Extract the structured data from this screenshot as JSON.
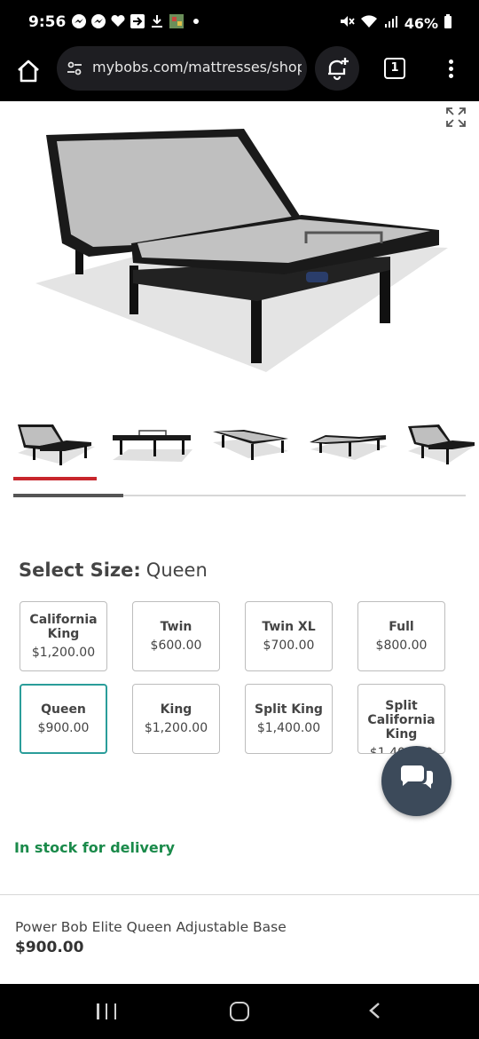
{
  "status_bar": {
    "time": "9:56",
    "battery": "46%",
    "icons": [
      "messenger-icon",
      "messenger-icon",
      "heart-message-icon",
      "forward-icon",
      "download-icon",
      "photo-icon",
      "dot-icon",
      "mute-icon",
      "wifi-icon",
      "signal-icon",
      "battery-icon"
    ]
  },
  "browser": {
    "url": "mybobs.com/mattresses/shop",
    "tab_count": "1"
  },
  "product": {
    "name_line": "Power Bob Elite Queen Adjustable Base",
    "price": "$900.00",
    "stock_text": "In stock for delivery"
  },
  "size_selector": {
    "label": "Select Size:",
    "selected": "Queen",
    "options": [
      {
        "name": "California King",
        "price": "$1,200.00"
      },
      {
        "name": "Twin",
        "price": "$600.00"
      },
      {
        "name": "Twin XL",
        "price": "$700.00"
      },
      {
        "name": "Full",
        "price": "$800.00"
      },
      {
        "name": "Queen",
        "price": "$900.00"
      },
      {
        "name": "King",
        "price": "$1,200.00"
      },
      {
        "name": "Split King",
        "price": "$1,400.00"
      },
      {
        "name": "Split California King",
        "price": "$1,400.00"
      }
    ]
  },
  "gallery": {
    "thumbnail_count": 5,
    "active_index": 0
  },
  "colors": {
    "accent_red": "#c8262c",
    "selected_teal": "#2a9d9a",
    "stock_green": "#1a8a4a",
    "chat_fab": "#3c4a5a"
  }
}
